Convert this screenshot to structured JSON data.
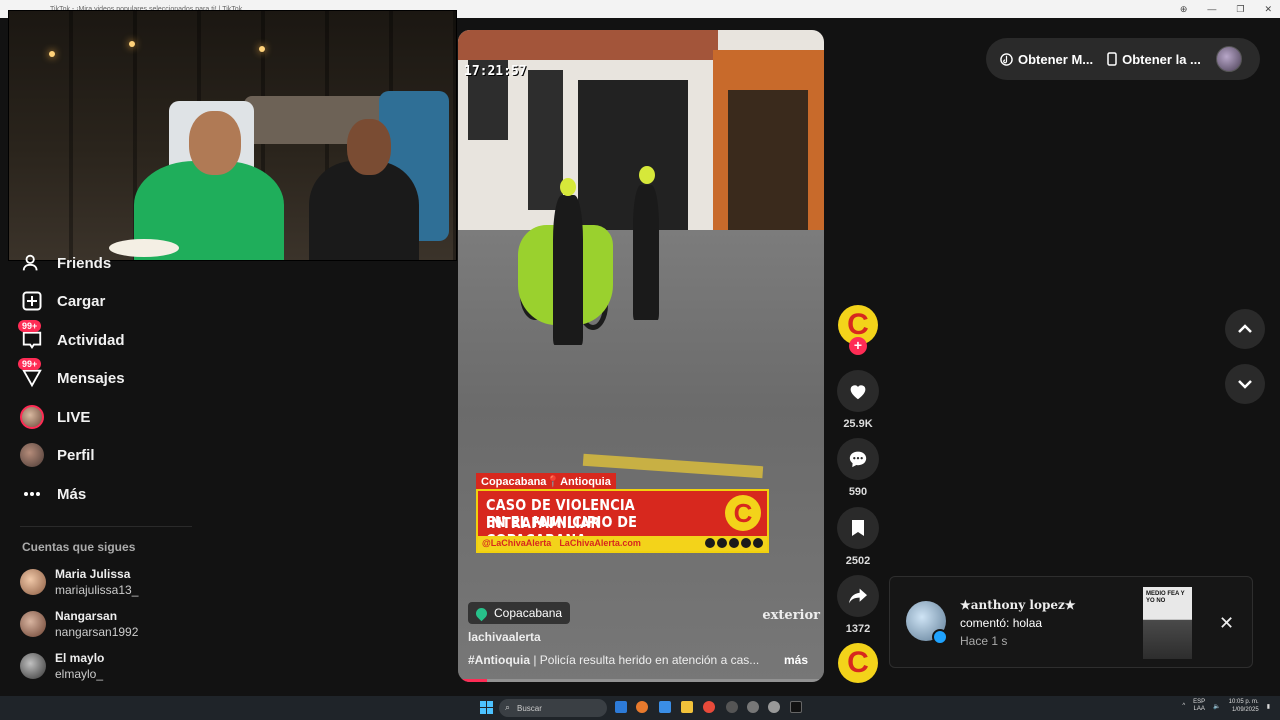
{
  "browser": {
    "tab_title": "TikTok - ¡Mira videos populares seleccionados para ti! | TikTok"
  },
  "sidebar": {
    "items": [
      {
        "label": "Friends",
        "icon": "friends-icon"
      },
      {
        "label": "Cargar",
        "icon": "upload-plus-icon"
      },
      {
        "label": "Actividad",
        "icon": "activity-icon",
        "badge": "99+"
      },
      {
        "label": "Mensajes",
        "icon": "messages-icon",
        "badge": "99+"
      },
      {
        "label": "LIVE",
        "icon": "live-avatar"
      },
      {
        "label": "Perfil",
        "icon": "profile-avatar"
      },
      {
        "label": "Más",
        "icon": "more-dots-icon"
      }
    ],
    "following_title": "Cuentas que sigues",
    "following": [
      {
        "name": "Maria Julissa",
        "handle": "mariajulissa13_"
      },
      {
        "name": "Nangarsan",
        "handle": "nangarsan1992"
      },
      {
        "name": "El maylo",
        "handle": "elmaylo_"
      }
    ]
  },
  "video": {
    "timestamp": "17:21:57",
    "news_tag": "Copacabana📍Antioquia",
    "news_line1": "CASO DE VIOLENCIA INTRAFAMILIAR",
    "news_line2": "EN EL MUNICIPIO DE COPACABANA",
    "news_logo": "C",
    "news_handle": "@LaChivaAlerta",
    "news_site": "LaChivaAlerta.com",
    "watermark": "exterior",
    "location": "Copacabana",
    "author": "lachivaalerta",
    "hashtag": "#Antioquia",
    "description": " | Policía resulta herido en atención a cas...",
    "more_label": "más",
    "progress": 0.08
  },
  "actions": {
    "creator_initial": "C",
    "follow_symbol": "+",
    "likes": "25.9K",
    "comments": "590",
    "saves": "2502",
    "shares": "1372"
  },
  "top_right": {
    "chip1": "Obtener M...",
    "chip2": "Obtener la ..."
  },
  "notification": {
    "username": "★anthony lopez★",
    "text": "comentó: holaa",
    "time": "Hace 1 s",
    "thumb_text": "MEDIO FEA Y YO NO"
  },
  "taskbar": {
    "search_placeholder": "Buscar",
    "lang1": "ESP",
    "lang2": "LAA",
    "time": "10:05 p. m.",
    "date": "1/09/2025"
  },
  "colors": {
    "accent": "#fe2c55",
    "news_red": "#d7281e",
    "news_yellow": "#f3d31a"
  }
}
